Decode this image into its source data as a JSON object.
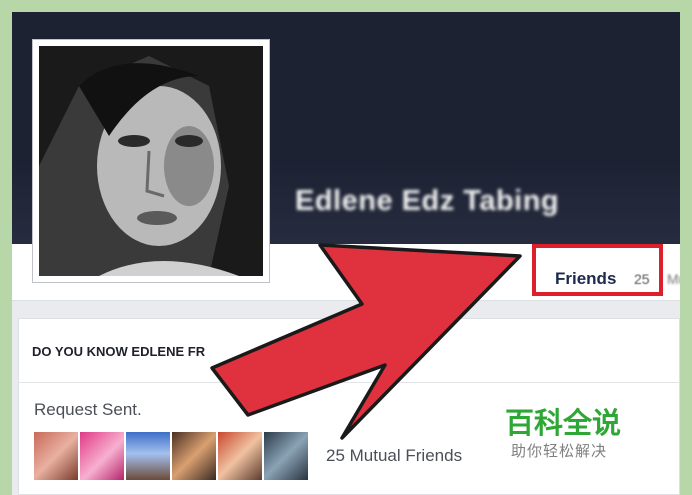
{
  "profile": {
    "name": "Edlene Edz Tabing"
  },
  "nav": {
    "friends_label": "Friends",
    "friends_count": "25",
    "friends_extra": "Mut"
  },
  "card": {
    "title": "DO YOU KNOW EDLENE FR",
    "request_status": "Request Sent.",
    "mutual_friends": "25 Mutual Friends"
  },
  "watermark": {
    "title": "百科全说",
    "subtitle": "助你轻松解决"
  },
  "colors": {
    "cover": "#1d2233",
    "highlight_box": "#dc1f2a",
    "arrow": "#e0323e",
    "watermark_green": "#2fa736"
  },
  "icons": {
    "arrow": "red-arrow-annotation"
  }
}
